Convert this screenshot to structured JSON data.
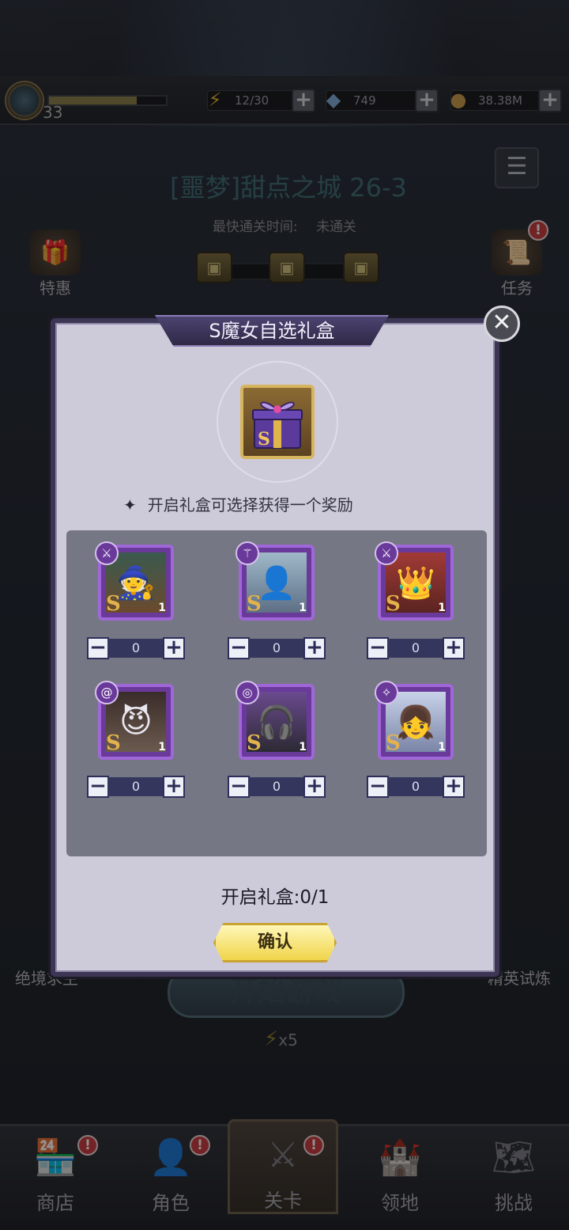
{
  "hud": {
    "level": "33",
    "xp_fraction": 0.75,
    "energy": "12/30",
    "diamonds": "749",
    "gold": "38.38M"
  },
  "stage": {
    "title": "[噩梦]甜点之城 26-3",
    "fastest_clear_label": "最快通关时间:",
    "fastest_clear_value": "未通关",
    "start_button": "开始游戏",
    "energy_cost": "x5"
  },
  "side_buttons": {
    "left_top": "特惠",
    "right_top": "任务",
    "left_bottom": "绝境求生",
    "right_bottom": "精英试炼"
  },
  "bottom_nav": [
    {
      "label": "商店",
      "alert": "!"
    },
    {
      "label": "角色",
      "alert": "!"
    },
    {
      "label": "关卡",
      "alert": "!"
    },
    {
      "label": "领地",
      "alert": ""
    },
    {
      "label": "挑战",
      "alert": ""
    }
  ],
  "modal": {
    "title": "S魔女自选礼盒",
    "description": "开启礼盒可选择获得一个奖励",
    "open_count": "开启礼盒:0/1",
    "confirm": "确认",
    "grade_letter": "S",
    "items": [
      {
        "count": "1",
        "quantity": "0",
        "type_icon": "sword"
      },
      {
        "count": "1",
        "quantity": "0",
        "type_icon": "staff"
      },
      {
        "count": "1",
        "quantity": "0",
        "type_icon": "sword"
      },
      {
        "count": "1",
        "quantity": "0",
        "type_icon": "swirl"
      },
      {
        "count": "1",
        "quantity": "0",
        "type_icon": "target"
      },
      {
        "count": "1",
        "quantity": "0",
        "type_icon": "wand"
      }
    ]
  }
}
